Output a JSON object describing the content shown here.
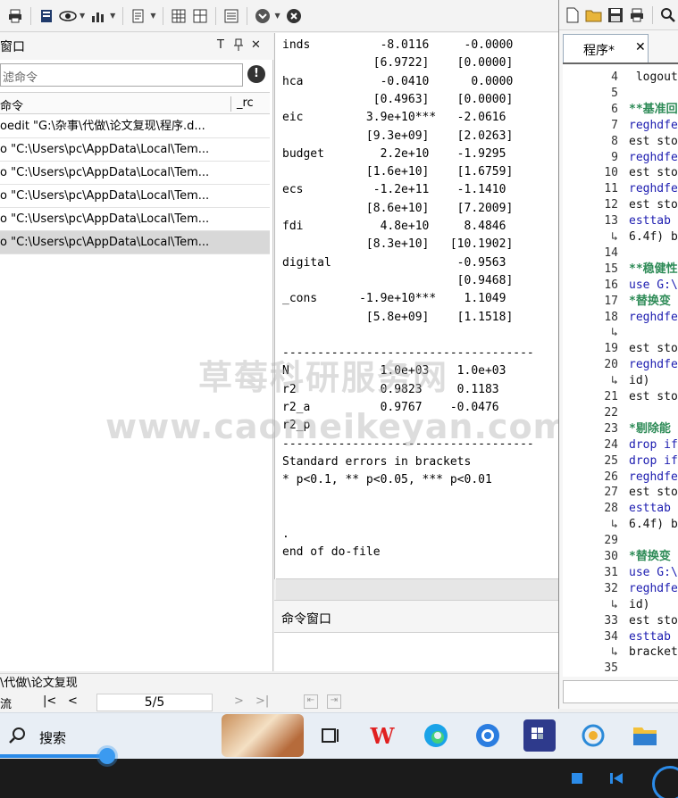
{
  "history": {
    "title": "窗口",
    "controls": [
      "T",
      "ꟷ",
      "✕"
    ],
    "filter_placeholder": "滤命令",
    "col_command": "命令",
    "col_rc": "_rc",
    "rows": [
      "oedit \"G:\\杂事\\代做\\论文复现\\程序.d...",
      "o \"C:\\Users\\pc\\AppData\\Local\\Tem...",
      "o \"C:\\Users\\pc\\AppData\\Local\\Tem...",
      "o \"C:\\Users\\pc\\AppData\\Local\\Tem...",
      "o \"C:\\Users\\pc\\AppData\\Local\\Tem...",
      "o \"C:\\Users\\pc\\AppData\\Local\\Tem..."
    ]
  },
  "path_bar": "\\代做\\论文复现",
  "nav": {
    "label": "流",
    "page": "5/5"
  },
  "results": {
    "lines": [
      "inds          -8.0116     -0.0000",
      "             [6.9722]    [0.0000]",
      "hca           -0.0410      0.0000",
      "             [0.4963]    [0.0000]",
      "eic         3.9e+10***   -2.0616",
      "            [9.3e+09]    [2.0263]",
      "budget        2.2e+10    -1.9295",
      "            [1.6e+10]    [1.6759]",
      "ecs          -1.2e+11    -1.1410",
      "            [8.6e+10]    [7.2009]",
      "fdi           4.8e+10     8.4846",
      "            [8.3e+10]   [10.1902]",
      "digital                  -0.9563",
      "                         [0.9468]",
      "_cons      -1.9e+10***    1.1049",
      "            [5.8e+09]    [1.1518]",
      "",
      "------------------------------------",
      "N             1.0e+03    1.0e+03",
      "r2            0.9823     0.1183",
      "r2_a          0.9767    -0.0476",
      "r2_p",
      "------------------------------------",
      "Standard errors in brackets",
      "* p<0.1, ** p<0.05, *** p<0.01",
      "",
      "",
      ".",
      "end of do-file",
      "",
      "."
    ]
  },
  "command_window": {
    "title": "命令窗口"
  },
  "editor": {
    "tab_label": "程序*",
    "tab_close": "✕",
    "lines": [
      {
        "n": "4",
        "text": " logout",
        "style": "plain"
      },
      {
        "n": "5",
        "text": "",
        "style": "plain"
      },
      {
        "n": "6",
        "text": "**基准回",
        "style": "cmt"
      },
      {
        "n": "7",
        "text": "reghdfe",
        "style": "kw"
      },
      {
        "n": "8",
        "text": "est sto",
        "style": "plain"
      },
      {
        "n": "9",
        "text": "reghdfe",
        "style": "kw"
      },
      {
        "n": "10",
        "text": "est sto",
        "style": "plain"
      },
      {
        "n": "11",
        "text": "reghdfe",
        "style": "kw"
      },
      {
        "n": "12",
        "text": "est sto",
        "style": "plain"
      },
      {
        "n": "13",
        "text": "esttab",
        "style": "kw"
      },
      {
        "n": "↳",
        "text": "6.4f) b",
        "style": "plain"
      },
      {
        "n": "14",
        "text": "",
        "style": "plain"
      },
      {
        "n": "15",
        "text": "**稳健性",
        "style": "cmt"
      },
      {
        "n": "16",
        "text": "use G:\\",
        "style": "kw"
      },
      {
        "n": "17",
        "text": "*替换变",
        "style": "cmt"
      },
      {
        "n": "18",
        "text": "reghdfe",
        "style": "kw"
      },
      {
        "n": "↳",
        "text": "",
        "style": "plain"
      },
      {
        "n": "19",
        "text": "est sto",
        "style": "plain"
      },
      {
        "n": "20",
        "text": "reghdfe",
        "style": "kw"
      },
      {
        "n": "↳",
        "text": "id)",
        "style": "plain"
      },
      {
        "n": "21",
        "text": "est sto",
        "style": "plain"
      },
      {
        "n": "22",
        "text": "",
        "style": "plain"
      },
      {
        "n": "23",
        "text": "*剔除能",
        "style": "cmt"
      },
      {
        "n": "24",
        "text": "drop if",
        "style": "kw"
      },
      {
        "n": "25",
        "text": "drop if",
        "style": "kw"
      },
      {
        "n": "26",
        "text": "reghdfe",
        "style": "kw"
      },
      {
        "n": "27",
        "text": "est sto",
        "style": "plain"
      },
      {
        "n": "28",
        "text": "esttab",
        "style": "kw"
      },
      {
        "n": "↳",
        "text": "6.4f) b",
        "style": "plain"
      },
      {
        "n": "29",
        "text": "",
        "style": "plain"
      },
      {
        "n": "30",
        "text": "*替换变",
        "style": "cmt"
      },
      {
        "n": "31",
        "text": "use G:\\",
        "style": "kw"
      },
      {
        "n": "32",
        "text": "reghdfe",
        "style": "kw"
      },
      {
        "n": "↳",
        "text": "id)",
        "style": "plain"
      },
      {
        "n": "33",
        "text": "est sto",
        "style": "plain"
      },
      {
        "n": "34",
        "text": "esttab",
        "style": "kw"
      },
      {
        "n": "↳",
        "text": "bracket",
        "style": "plain"
      },
      {
        "n": "35",
        "text": "",
        "style": "plain"
      }
    ]
  },
  "watermark": {
    "line1": "草莓科研服务网",
    "line2": "www.caomeikeyan.com"
  },
  "taskbar": {
    "search_label": "搜索"
  },
  "colors": {
    "accent": "#2b8be8",
    "selected_row": "#d8d8d8",
    "comment": "#2e8b57",
    "keyword": "#1c1cb0"
  }
}
